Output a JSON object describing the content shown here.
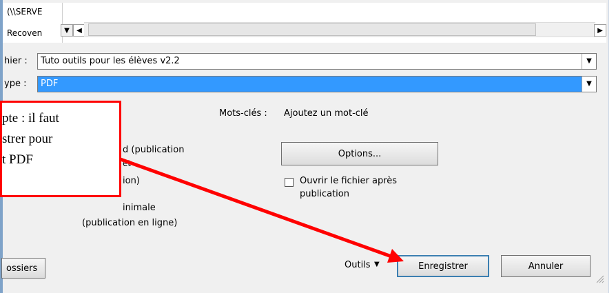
{
  "top": {
    "path_text": "(\\\\SERVE",
    "recover_text": "Recoven"
  },
  "filename": {
    "label": "hier :",
    "value": "Tuto outils pour les élèves v2.2"
  },
  "filetype": {
    "label": "ype :",
    "value": "PDF"
  },
  "keywords": {
    "label": "Mots-clés :",
    "placeholder": "Ajoutez un mot-clé"
  },
  "options": {
    "standard_line1": "d (publication",
    "standard_line2": "et",
    "standard_line3": "ion)",
    "minimal_line1": "inimale",
    "minimal_line2": "(publication en ligne)",
    "options_button": "Options...",
    "open_after_label_line1": "Ouvrir le fichier après",
    "open_after_label_line2": "publication"
  },
  "callout": {
    "line1": "pte : il faut",
    "line2": "strer pour",
    "line3": "t PDF"
  },
  "footer": {
    "folders_button": "ossiers",
    "tools_label": "Outils",
    "save_button": "Enregistrer",
    "cancel_button": "Annuler"
  },
  "colors": {
    "selection": "#3399ff",
    "annotation_red": "#ff0000"
  }
}
